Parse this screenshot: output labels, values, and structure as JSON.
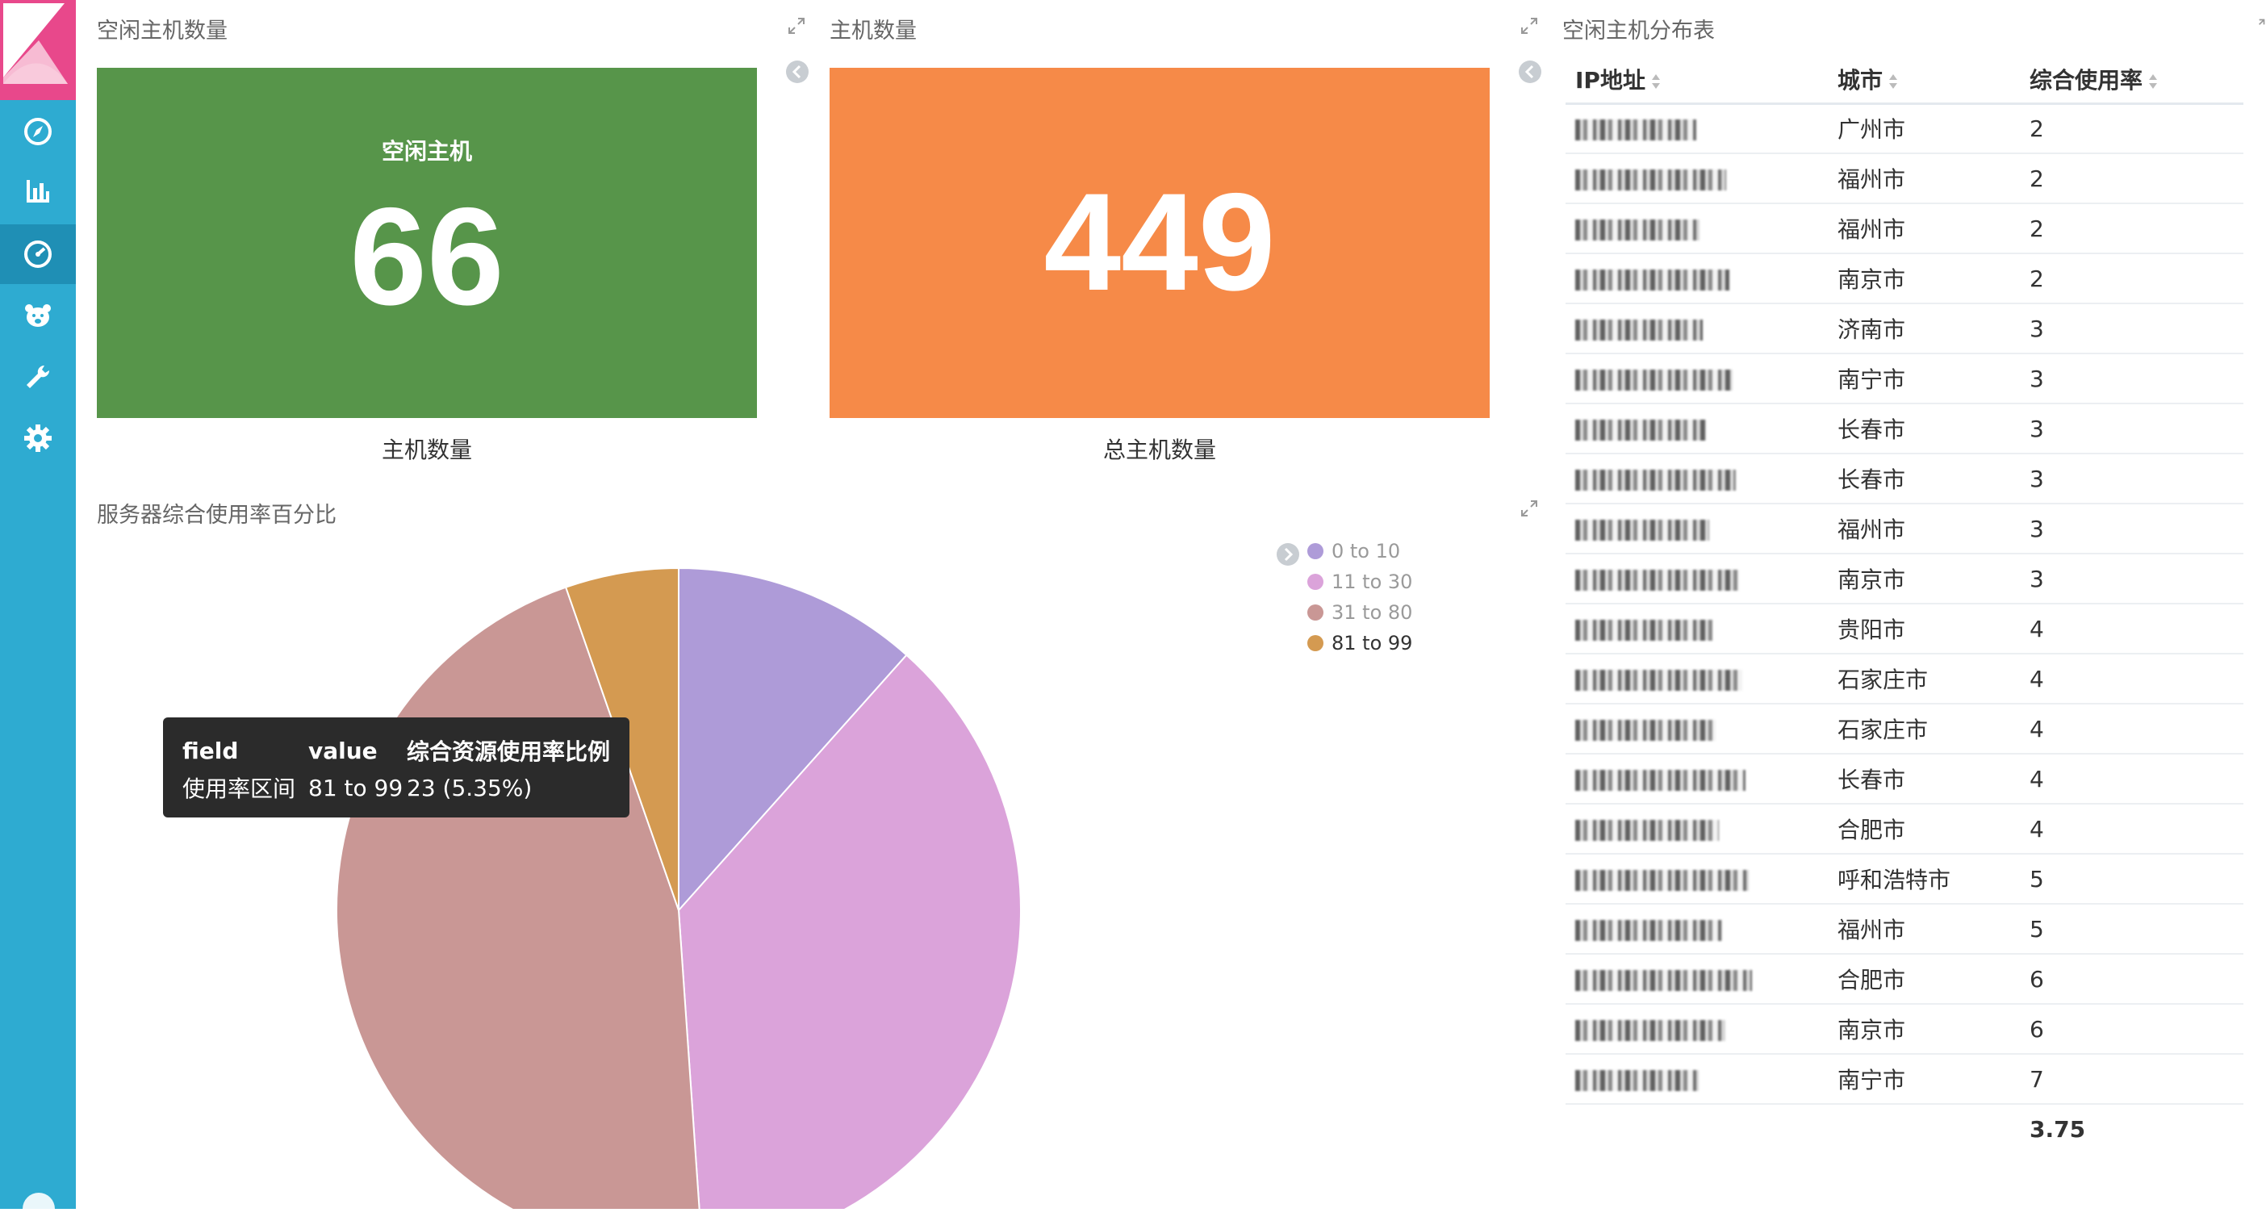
{
  "sidebar": {
    "items": [
      {
        "icon": "compass-icon",
        "active": false
      },
      {
        "icon": "bar-chart-icon",
        "active": false
      },
      {
        "icon": "dashboard-gauge-icon",
        "active": true
      },
      {
        "icon": "timelion-bear-icon",
        "active": false
      },
      {
        "icon": "wrench-icon",
        "active": false
      },
      {
        "icon": "gear-icon",
        "active": false
      }
    ]
  },
  "panels": {
    "idle_hosts": {
      "title": "空闲主机数量",
      "label": "空闲主机",
      "value": "66",
      "caption": "主机数量",
      "color": "#57954a"
    },
    "hosts": {
      "title": "主机数量",
      "value": "449",
      "caption": "总主机数量",
      "color": "#f68a48"
    },
    "idle_table": {
      "title": "空闲主机分布表",
      "columns": [
        "IP地址",
        "城市",
        "综合使用率"
      ],
      "rows": [
        {
          "city": "广州市",
          "usage": "2"
        },
        {
          "city": "福州市",
          "usage": "2"
        },
        {
          "city": "福州市",
          "usage": "2"
        },
        {
          "city": "南京市",
          "usage": "2"
        },
        {
          "city": "济南市",
          "usage": "3"
        },
        {
          "city": "南宁市",
          "usage": "3"
        },
        {
          "city": "长春市",
          "usage": "3"
        },
        {
          "city": "长春市",
          "usage": "3"
        },
        {
          "city": "福州市",
          "usage": "3"
        },
        {
          "city": "南京市",
          "usage": "3"
        },
        {
          "city": "贵阳市",
          "usage": "4"
        },
        {
          "city": "石家庄市",
          "usage": "4"
        },
        {
          "city": "石家庄市",
          "usage": "4"
        },
        {
          "city": "长春市",
          "usage": "4"
        },
        {
          "city": "合肥市",
          "usage": "4"
        },
        {
          "city": "呼和浩特市",
          "usage": "5"
        },
        {
          "city": "福州市",
          "usage": "5"
        },
        {
          "city": "合肥市",
          "usage": "6"
        },
        {
          "city": "南京市",
          "usage": "6"
        },
        {
          "city": "南宁市",
          "usage": "7"
        }
      ],
      "footer_avg": "3.75"
    },
    "pie": {
      "title": "服务器综合使用率百分比",
      "legend": [
        {
          "label": "0 to 10",
          "color": "#ae9bd8",
          "dimmed": true
        },
        {
          "label": "11 to 30",
          "color": "#dba3da",
          "dimmed": true
        },
        {
          "label": "31 to 80",
          "color": "#c99795",
          "dimmed": true
        },
        {
          "label": "81 to 99",
          "color": "#d49a51",
          "dimmed": false
        }
      ],
      "tooltip": {
        "headers": [
          "field",
          "value",
          "综合资源使用率比例"
        ],
        "row": [
          "使用率区间",
          "81 to 99",
          "23 (5.35%)"
        ]
      }
    }
  },
  "chart_data": {
    "type": "pie",
    "categories": [
      "0 to 10",
      "11 to 30",
      "31 to 80",
      "81 to 99"
    ],
    "values": [
      11.6,
      37.3,
      45.75,
      5.35
    ],
    "unit": "percent"
  }
}
